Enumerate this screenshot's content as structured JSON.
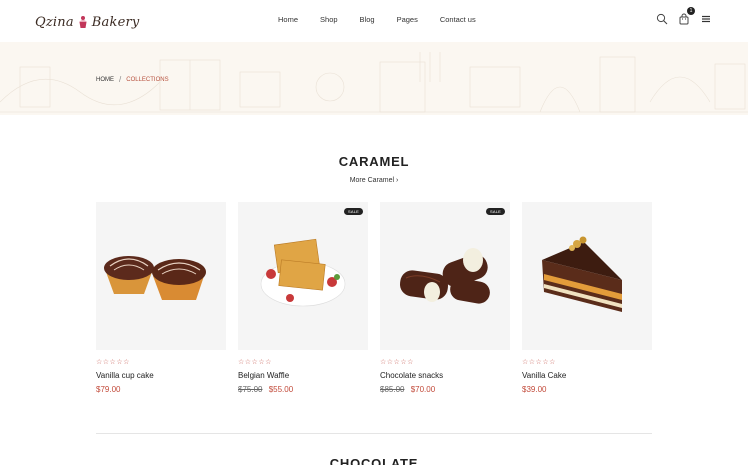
{
  "header": {
    "logo_left": "Qzina",
    "logo_right": "Bakery",
    "nav": [
      "Home",
      "Shop",
      "Blog",
      "Pages",
      "Contact us"
    ],
    "cart_count": "1"
  },
  "breadcrumb": {
    "home": "HOME",
    "separator": "/",
    "current": "COLLECTIONS"
  },
  "section": {
    "title": "CARAMEL",
    "more_link": "More Caramel ›"
  },
  "products": [
    {
      "name": "Vanilla cup cake",
      "old_price": "",
      "price": "$79.00",
      "sale": "",
      "stars": "☆☆☆☆☆"
    },
    {
      "name": "Belgian Waffle",
      "old_price": "$75.00",
      "price": "$55.00",
      "sale": "SALE",
      "stars": "☆☆☆☆☆"
    },
    {
      "name": "Chocolate snacks",
      "old_price": "$85.00",
      "price": "$70.00",
      "sale": "SALE",
      "stars": "☆☆☆☆☆"
    },
    {
      "name": "Vanilla Cake",
      "old_price": "",
      "price": "$39.00",
      "sale": "",
      "stars": "☆☆☆☆☆"
    }
  ],
  "section2": {
    "title": "CHOCOLATE"
  },
  "colors": {
    "accent": "#c24a3a",
    "banner_bg": "#fbf7f1",
    "card_bg": "#f5f5f5"
  }
}
